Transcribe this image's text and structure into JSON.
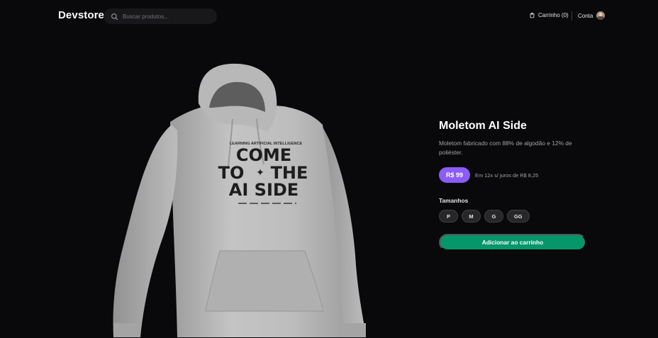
{
  "header": {
    "logo": "Devstore",
    "search": {
      "placeholder": "Buscar produtos..."
    },
    "cart_label": "Carrinho (0)",
    "account_label": "Conta"
  },
  "product": {
    "name": "Moletom AI Side",
    "description": "Moletom fabricado com 88% de algodão e 12% de poliéster.",
    "price": "R$ 99",
    "installments": "Em 12x s/ juros de R$ 8,25",
    "image": {
      "print_top": "LEARNING ARTIFICIAL INTELLIGENCE",
      "print_line1": "COME",
      "print_line2a": "TO",
      "print_line2b": "THE",
      "print_line3": "AI SIDE"
    },
    "sizes_label": "Tamanhos",
    "sizes": [
      "P",
      "M",
      "G",
      "GG"
    ],
    "add_to_cart": "Adicionar ao carrinho"
  },
  "colors": {
    "background": "#09090b",
    "price_badge": "#8b5cf6",
    "add_button": "#059669"
  },
  "icons": [
    "search-icon",
    "shopping-bag-icon"
  ]
}
